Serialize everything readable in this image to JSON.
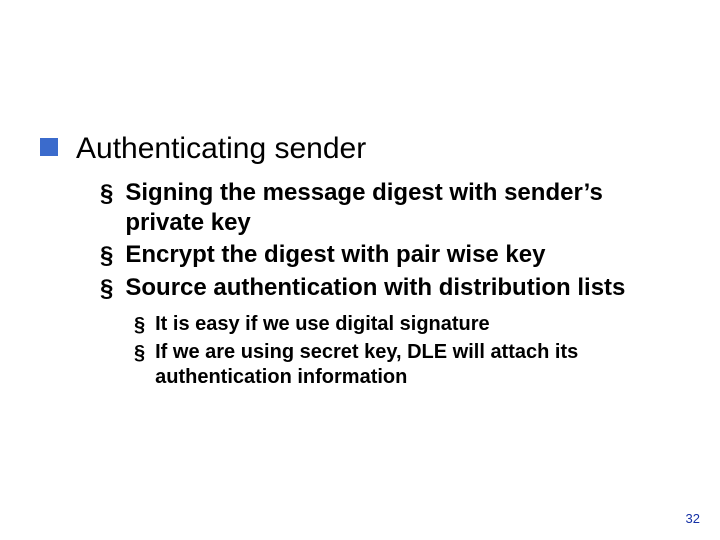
{
  "slide": {
    "level1": {
      "text": "Authenticating sender"
    },
    "level2": [
      {
        "text": "Signing the message digest with sender’s private key"
      },
      {
        "text": "Encrypt the digest with pair wise key"
      },
      {
        "text": "Source authentication with distribution lists"
      }
    ],
    "level3": [
      {
        "text": "It is easy if we use digital signature"
      },
      {
        "text": "If we are using secret key, DLE will attach its authentication information"
      }
    ],
    "bullet_glyph": "§",
    "page_number": "32"
  }
}
